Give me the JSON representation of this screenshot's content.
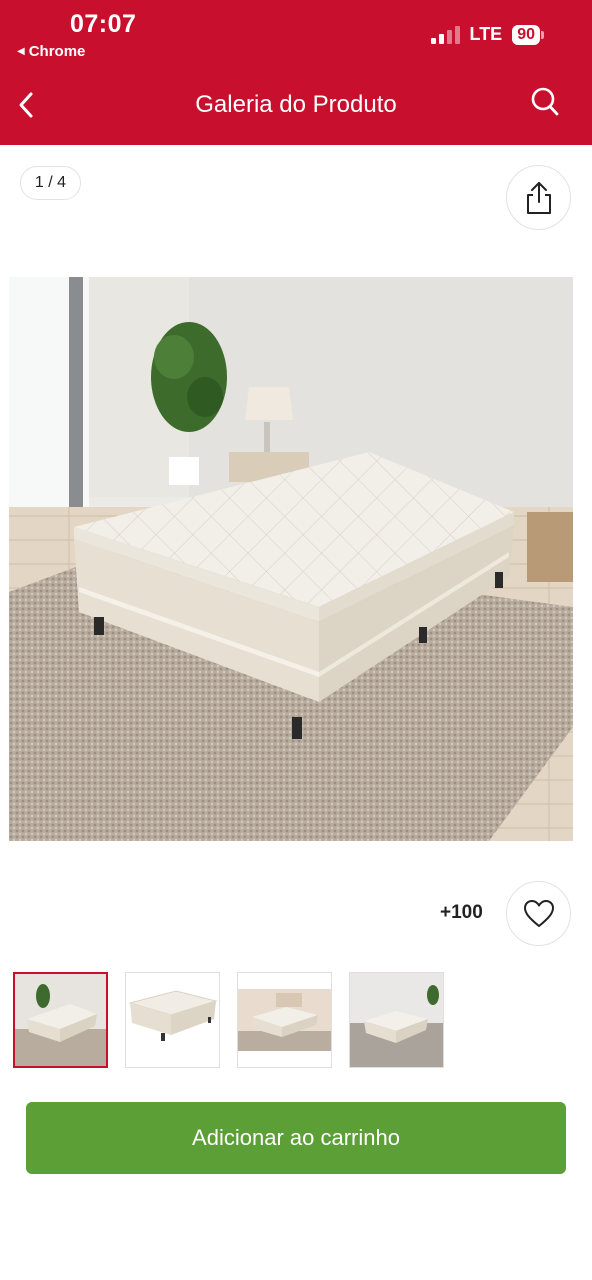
{
  "status_bar": {
    "time": "07:07",
    "back_app": "Chrome",
    "network": "LTE",
    "battery": "90"
  },
  "nav": {
    "title": "Galeria do Produto",
    "back_icon": "chevron-left-icon",
    "search_icon": "search-icon"
  },
  "gallery": {
    "counter": "1 / 4",
    "share_icon": "share-icon",
    "likes": "+100",
    "like_icon": "heart-icon",
    "thumbnails_count": 4,
    "active_thumbnail": 1
  },
  "cta": {
    "label": "Adicionar ao carrinho"
  },
  "colors": {
    "brand": "#c8102e",
    "cta": "#5c9f36"
  }
}
